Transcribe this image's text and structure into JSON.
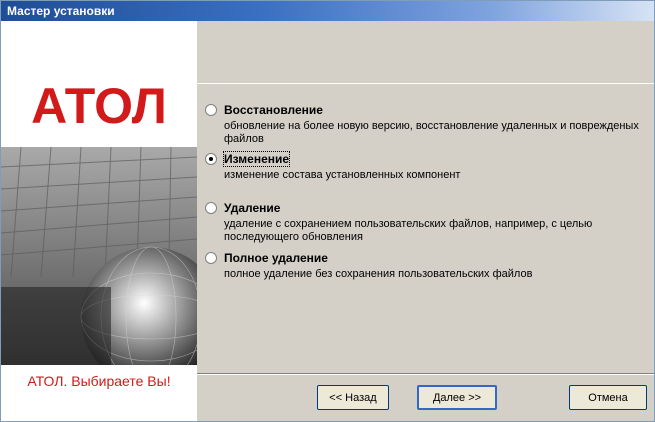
{
  "window": {
    "title": "Мастер установки"
  },
  "branding": {
    "logo_text": "АТОЛ",
    "slogan": "АТОЛ. Выбираете Вы!",
    "brand_color": "#d21a1a"
  },
  "options": [
    {
      "title": "Восстановление",
      "description": "обновление на более новую версию, восстановление удаленных и поврежденых файлов",
      "selected": false
    },
    {
      "title": "Изменение",
      "description": "изменение состава установленных компонент",
      "selected": true
    },
    {
      "title": "Удаление",
      "description": "удаление с сохранением пользовательских файлов, например, с целью последующего обновления",
      "selected": false
    },
    {
      "title": "Полное удаление",
      "description": "полное удаление без сохранения пользовательских файлов",
      "selected": false
    }
  ],
  "buttons": {
    "back": "<< Назад",
    "next": "Далее >>",
    "cancel": "Отмена"
  }
}
